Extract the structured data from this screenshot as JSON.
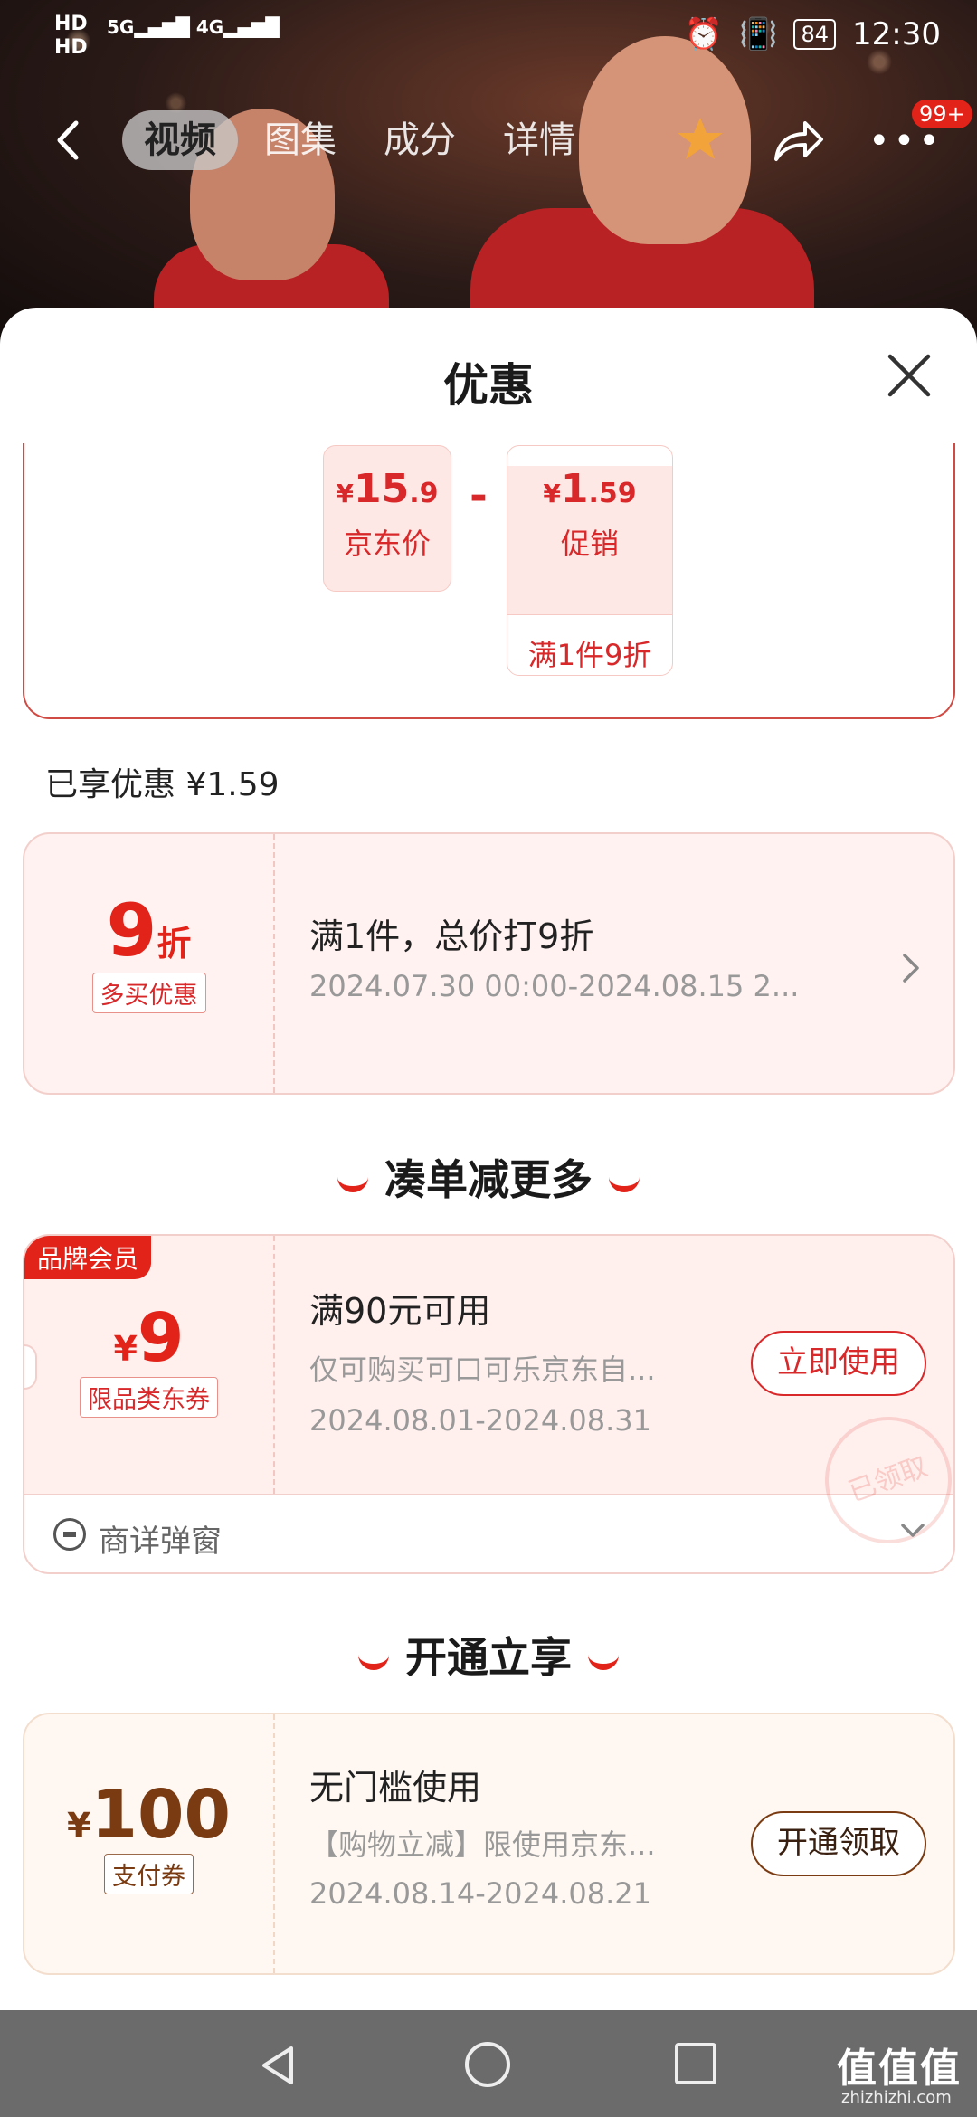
{
  "status_bar": {
    "hd1": "HD",
    "hd2": "HD",
    "net1": "5G",
    "net2": "4G",
    "battery": "84",
    "time": "12:30"
  },
  "top_nav": {
    "tabs": [
      {
        "label": "视频",
        "active": true
      },
      {
        "label": "图集",
        "active": false
      },
      {
        "label": "成分",
        "active": false
      },
      {
        "label": "详情",
        "active": false
      }
    ],
    "badge": "99+",
    "icons": [
      "back-icon",
      "star-icon",
      "share-icon",
      "more-icon"
    ]
  },
  "sheet": {
    "title": "优惠",
    "summary": {
      "jd_price_int": "15",
      "jd_price_dec": ".9",
      "jd_price_label": "京东价",
      "promo_price_int": "1",
      "promo_price_dec": ".59",
      "promo_label": "促销",
      "promo_rule": "满1件9折",
      "currency": "¥",
      "minus": "-"
    },
    "enjoyed": "已享优惠 ¥1.59",
    "discount_coupon": {
      "value": "9",
      "unit": "折",
      "tag": "多买优惠",
      "title": "满1件，总价打9折",
      "period": "2024.07.30 00:00-2024.08.15 2..."
    },
    "section_more": "凑单减更多",
    "brand_coupon": {
      "badge": "品牌会员",
      "currency": "¥",
      "value": "9",
      "tag": "限品类东券",
      "title": "满90元可用",
      "desc": "仅可购买可口可乐京东自...",
      "period": "2024.08.01-2024.08.31",
      "button": "立即使用",
      "stamp": "已领取",
      "popup_label": "商详弹窗"
    },
    "section_open": "开通立享",
    "pay_coupon": {
      "currency": "¥",
      "value": "100",
      "tag": "支付券",
      "title": "无门槛使用",
      "desc": "【购物立减】限使用京东...",
      "period": "2024.08.14-2024.08.21",
      "button": "开通领取"
    }
  },
  "watermark": {
    "text": "值值值",
    "sub": "zhizhizhi.com"
  },
  "colors": {
    "accent_red": "#e2231a",
    "brown": "#7a3b12"
  }
}
